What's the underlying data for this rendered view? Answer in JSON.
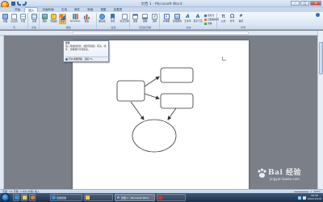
{
  "window": {
    "title": "文档 1 - Microsoft Word"
  },
  "tabs": [
    {
      "label": "开始",
      "active": false
    },
    {
      "label": "插入",
      "active": true
    },
    {
      "label": "页面布局",
      "active": false
    },
    {
      "label": "引用",
      "active": false
    },
    {
      "label": "邮件",
      "active": false
    },
    {
      "label": "审阅",
      "active": false
    },
    {
      "label": "视图",
      "active": false
    },
    {
      "label": "加载项",
      "active": false
    }
  ],
  "ribbon": {
    "groups": [
      {
        "label": "页"
      },
      {
        "label": "表格"
      },
      {
        "label": "插图"
      },
      {
        "label": "链接"
      },
      {
        "label": "页眉和页脚"
      },
      {
        "label": "文本"
      },
      {
        "label": "符号"
      }
    ],
    "buttons": [
      {
        "label": "封面",
        "icon": "cover-page-icon"
      },
      {
        "label": "空白页",
        "icon": "blank-page-icon"
      },
      {
        "label": "分页",
        "icon": "page-break-icon"
      },
      {
        "label": "表格",
        "icon": "table-icon"
      },
      {
        "label": "图片",
        "icon": "picture-icon"
      },
      {
        "label": "剪贴画",
        "icon": "clipart-icon"
      },
      {
        "label": "形状",
        "icon": "shapes-icon"
      },
      {
        "label": "SmartArt",
        "icon": "smartart-icon"
      },
      {
        "label": "图表",
        "icon": "chart-icon"
      },
      {
        "label": "超链接",
        "icon": "hyperlink-icon"
      },
      {
        "label": "书签",
        "icon": "bookmark-icon"
      },
      {
        "label": "交叉引用",
        "icon": "cross-reference-icon"
      },
      {
        "label": "页眉",
        "icon": "header-icon"
      },
      {
        "label": "页脚",
        "icon": "footer-icon"
      },
      {
        "label": "页码",
        "icon": "page-number-icon"
      },
      {
        "label": "文本框",
        "icon": "textbox-icon"
      },
      {
        "label": "文档部件",
        "icon": "quick-parts-icon"
      },
      {
        "label": "艺术字",
        "icon": "wordart-icon"
      },
      {
        "label": "首字下沉",
        "icon": "dropcap-icon"
      },
      {
        "label": "公式",
        "icon": "equation-icon"
      },
      {
        "label": "符号",
        "icon": "symbol-icon"
      },
      {
        "label": "编号",
        "icon": "number-icon"
      }
    ],
    "small": [
      "签名行",
      "日期和时间",
      "对象"
    ]
  },
  "tooltip": {
    "title": "形状",
    "body": "插入现成的形状，如矩形和圆、箭头、线条、流程图符号和标注。",
    "help": "有关详细帮助，请按 F1。"
  },
  "statusbar": {
    "left": "页面: 1/1   字数: 0   中文(中国)   插入",
    "zoom": "100%"
  },
  "taskbar": {
    "items": [
      {
        "label": "百度经验",
        "icon": "browser-icon",
        "active": false
      },
      {
        "label": "",
        "icon": "folder-icon",
        "active": false
      },
      {
        "label": "文档 1 - Microsoft Word",
        "icon": "word-icon",
        "active": true
      },
      {
        "label": "",
        "icon": "app-icon",
        "active": false
      }
    ],
    "time": "18:36",
    "date": "2013/12/10"
  },
  "watermark": {
    "text": "Bai 经验",
    "url": "jingyan.baidu.com"
  },
  "colors": {
    "accent": "#2b579a",
    "ribbon": "#dce7f5",
    "highlight": "#ffd874"
  }
}
